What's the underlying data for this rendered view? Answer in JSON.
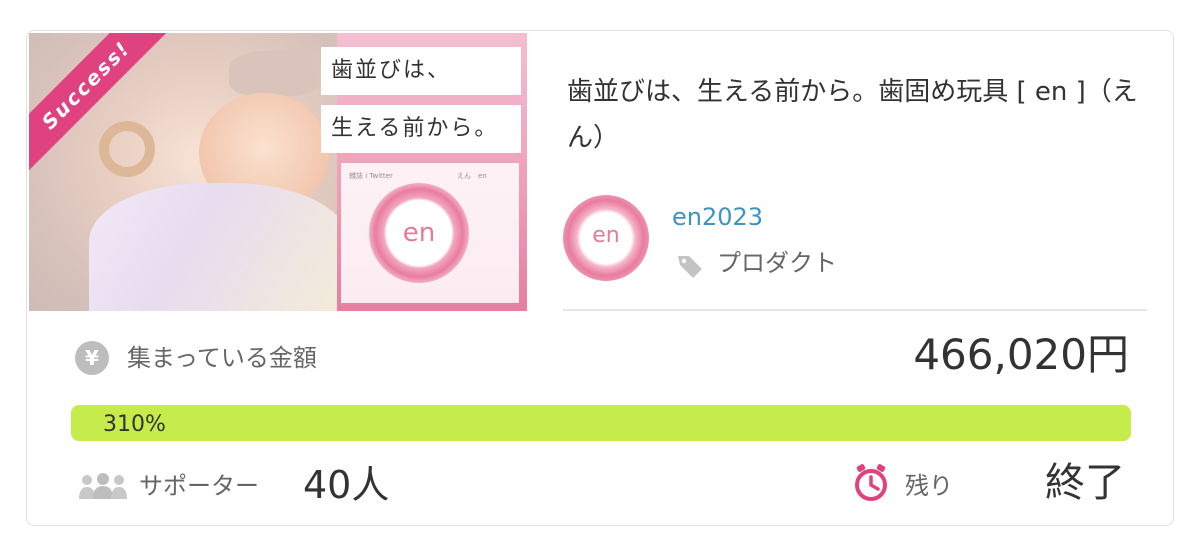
{
  "badge": {
    "label": "Success!"
  },
  "thumbnail": {
    "line1": "歯並びは、",
    "line2": "生える前から。",
    "small_left": "雑誌 i Twitter",
    "small_right": "えん　en",
    "logo_text": "en"
  },
  "project": {
    "title": "歯並びは、生える前から。歯固め玩具 [ en ]（えん）"
  },
  "owner": {
    "avatar_text": "en",
    "username": "en2023",
    "category": "プロダクト",
    "category_icon": "tag-icon"
  },
  "funding": {
    "icon": "yen-icon",
    "icon_glyph": "¥",
    "label": "集まっている金額",
    "amount": "466,020円",
    "progress_label": "310%",
    "progress_fraction": 1.0,
    "progress_color": "#c6ec4c"
  },
  "supporters": {
    "icon": "people-icon",
    "label": "サポーター",
    "count": "40人"
  },
  "remaining": {
    "icon": "timer-icon",
    "label": "残り",
    "value": "終了"
  },
  "colors": {
    "accent_pink": "#e0417f",
    "link_blue": "#3d94c4",
    "progress_green": "#c6ec4c"
  }
}
